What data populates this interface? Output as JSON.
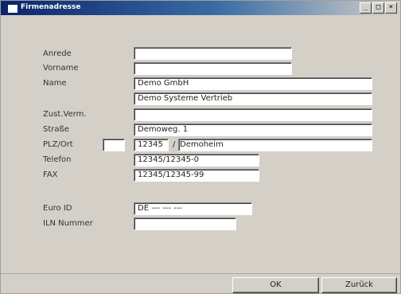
{
  "window": {
    "title": "Firmenadresse",
    "controls": {
      "minimize": "_",
      "maximize": "□",
      "close": "×"
    }
  },
  "form": {
    "anrede": {
      "label": "Anrede",
      "value": ""
    },
    "vorname": {
      "label": "Vorname",
      "value": ""
    },
    "name": {
      "label": "Name",
      "value": "Demo GmbH",
      "value2": "Demo Systeme Vertrieb"
    },
    "zust": {
      "label": "Zust.Verm.",
      "value": ""
    },
    "strasse": {
      "label": "Straße",
      "value": "Demoweg. 1"
    },
    "plzort": {
      "label": "PLZ/Ort",
      "country": "",
      "plz": "12345",
      "separator": "/",
      "ort": "Demoheim"
    },
    "telefon": {
      "label": "Telefon",
      "value": "12345/12345-0"
    },
    "fax": {
      "label": "FAX",
      "value": "12345/12345-99"
    },
    "euroid": {
      "label": "Euro ID",
      "value": "DE --- --- ---"
    },
    "iln": {
      "label": "ILN Nummer",
      "value": ""
    }
  },
  "buttons": {
    "ok": "OK",
    "back": "Zurück"
  }
}
